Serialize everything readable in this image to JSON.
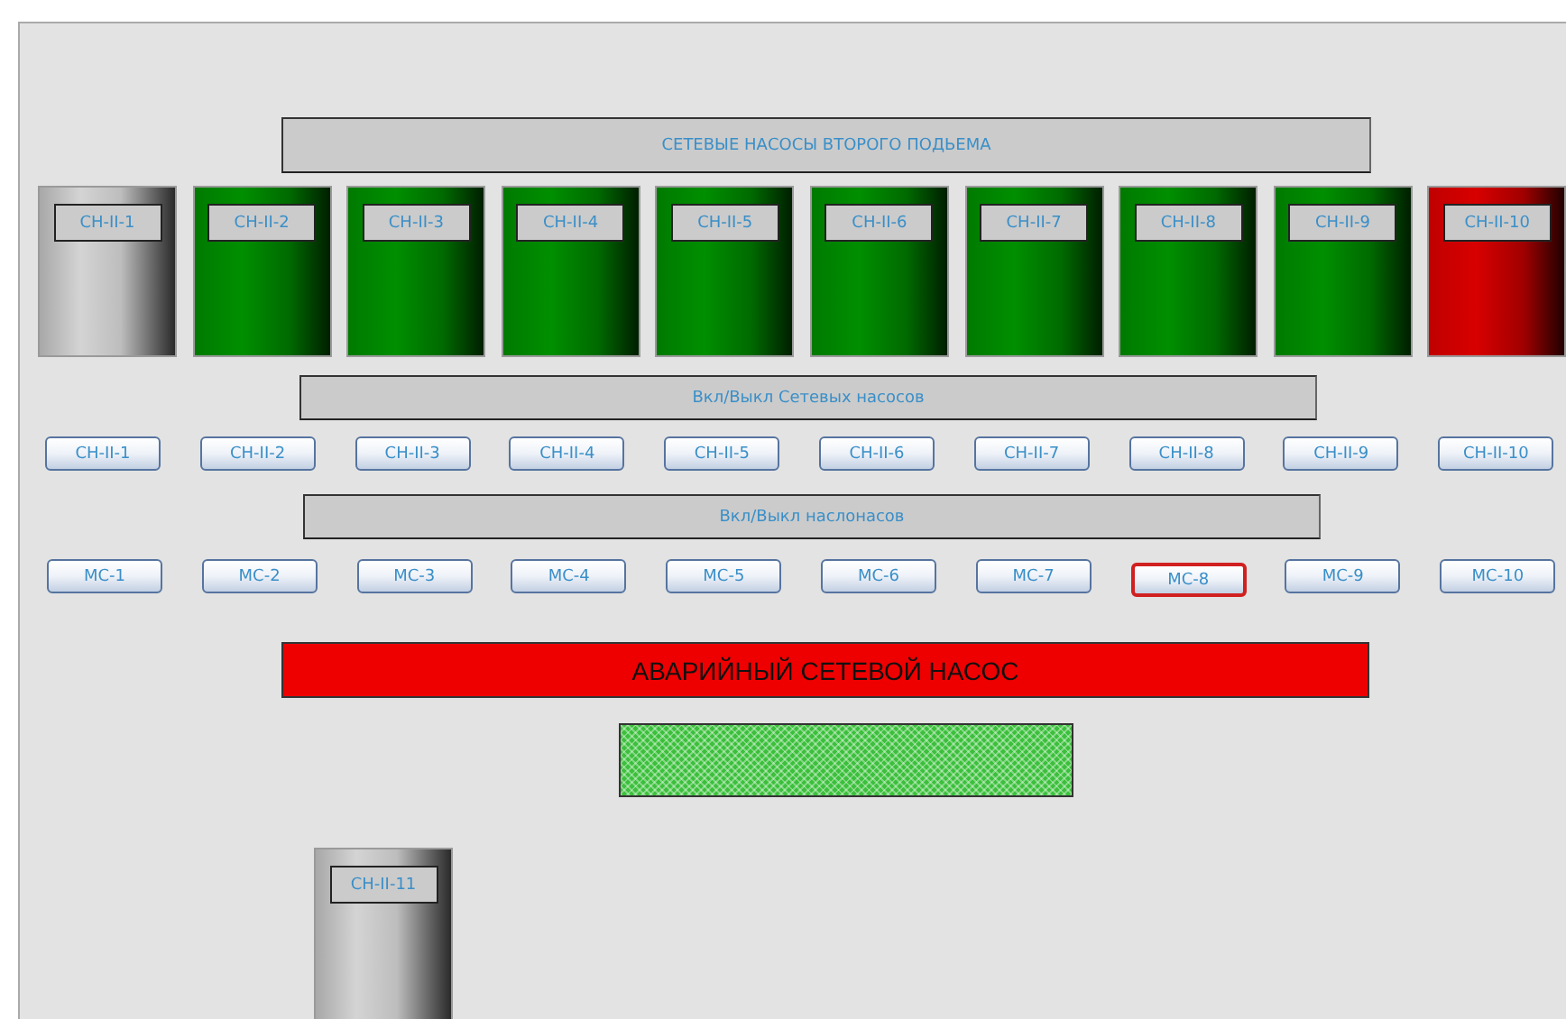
{
  "title": "СЕТЕВЫЕ НАСОСЫ ВТОРОГО ПОДЬЕМА",
  "pumps": [
    {
      "label": "СН-II-1",
      "running": false,
      "fault": false
    },
    {
      "label": "СН-II-2",
      "running": true,
      "fault": false
    },
    {
      "label": "СН-II-3",
      "running": true,
      "fault": false
    },
    {
      "label": "СН-II-4",
      "running": true,
      "fault": false
    },
    {
      "label": "СН-II-5",
      "running": true,
      "fault": false
    },
    {
      "label": "СН-II-6",
      "running": true,
      "fault": false
    },
    {
      "label": "СН-II-7",
      "running": true,
      "fault": false
    },
    {
      "label": "СН-II-8",
      "running": true,
      "fault": false
    },
    {
      "label": "СН-II-9",
      "running": true,
      "fault": false
    },
    {
      "label": "СН-II-10",
      "running": false,
      "fault": true
    }
  ],
  "pump_toggles": {
    "title": "Вкл/Выкл Сетевых насосов",
    "buttons": [
      {
        "label": "СН-II-1"
      },
      {
        "label": "СН-II-2"
      },
      {
        "label": "СН-II-3"
      },
      {
        "label": "СН-II-4"
      },
      {
        "label": "СН-II-5"
      },
      {
        "label": "СН-II-6"
      },
      {
        "label": "СН-II-7"
      },
      {
        "label": "СН-II-8"
      },
      {
        "label": "СН-II-9"
      },
      {
        "label": "СН-II-10"
      }
    ]
  },
  "oil_pump_toggles": {
    "title": "Вкл/Выкл наслонасов",
    "buttons": [
      {
        "label": "МС-1",
        "selected": false
      },
      {
        "label": "МС-2",
        "selected": false
      },
      {
        "label": "МС-3",
        "selected": false
      },
      {
        "label": "МС-4",
        "selected": false
      },
      {
        "label": "МС-5",
        "selected": false
      },
      {
        "label": "МС-6",
        "selected": false
      },
      {
        "label": "МС-7",
        "selected": false
      },
      {
        "label": "МС-8",
        "selected": true
      },
      {
        "label": "МС-9",
        "selected": false
      },
      {
        "label": "МС-10",
        "selected": false
      }
    ]
  },
  "alarm": {
    "text": "АВАРИЙНЫЙ СЕТЕВОЙ НАСОС",
    "active": true
  },
  "spare_pump": {
    "label": "СН-II-11",
    "running": false,
    "fault": false
  }
}
